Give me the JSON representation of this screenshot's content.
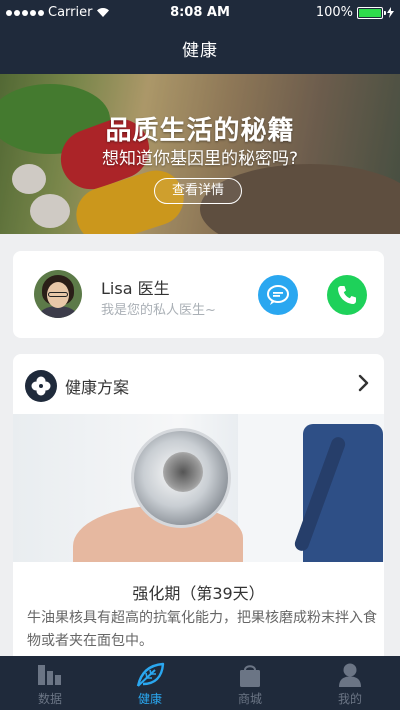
{
  "status": {
    "carrier": "Carrier",
    "time": "8:08 AM",
    "battery": "100%"
  },
  "nav": {
    "title": "健康"
  },
  "banner": {
    "title": "品质生活的秘籍",
    "subtitle": "想知道你基因里的秘密吗?",
    "button": "查看详情"
  },
  "doctor": {
    "name": "Lisa 医生",
    "description": "我是您的私人医生~",
    "chat_color": "#2aa7f0",
    "call_color": "#1ed15a"
  },
  "plan": {
    "title": "健康方案",
    "subtitle": "强化期（第39天）",
    "description": "牛油果核具有超高的抗氧化能力，把果核磨成粉末拌入食物或者夹在面包中。"
  },
  "tabs": [
    {
      "label": "数据",
      "icon": "bar-chart-icon",
      "active": false
    },
    {
      "label": "健康",
      "icon": "leaf-icon",
      "active": true
    },
    {
      "label": "商城",
      "icon": "shopping-bag-icon",
      "active": false
    },
    {
      "label": "我的",
      "icon": "user-icon",
      "active": false
    }
  ],
  "colors": {
    "nav_bg": "#1f2a3b",
    "accent": "#2aa7f0",
    "battery": "#2edb4b"
  }
}
